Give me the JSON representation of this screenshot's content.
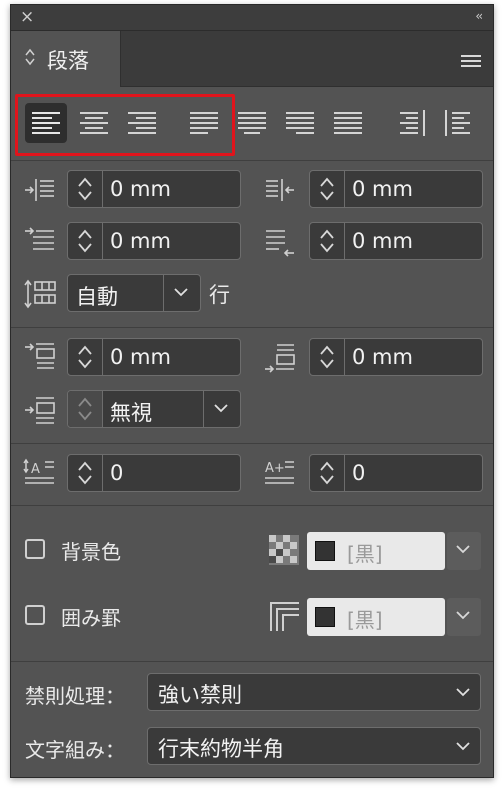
{
  "window": {
    "close_glyph": "×",
    "collapse_glyph": "‹‹"
  },
  "tab": {
    "label": "段落"
  },
  "alignment": {
    "buttons": [
      {
        "name": "align-left",
        "active": true
      },
      {
        "name": "align-center",
        "active": false
      },
      {
        "name": "align-right",
        "active": false
      },
      {
        "name": "justify-left",
        "active": false
      },
      {
        "name": "justify-center",
        "active": false
      },
      {
        "name": "justify-right",
        "active": false
      },
      {
        "name": "justify-all",
        "active": false
      },
      {
        "name": "align-toward-spine",
        "active": false
      },
      {
        "name": "align-away-from-spine",
        "active": false
      }
    ],
    "highlight_color": "#e0141c"
  },
  "indents": {
    "left_indent": "0 mm",
    "right_indent": "0 mm",
    "first_line_indent": "0 mm",
    "last_line_right_indent": "0 mm"
  },
  "leading": {
    "value": "自動",
    "suffix": "行"
  },
  "spacing": {
    "space_before": "0 mm",
    "space_after": "0 mm",
    "grid_align": "無視"
  },
  "dropcap": {
    "lines": "0",
    "chars": "0"
  },
  "shading": {
    "label": "背景色",
    "color_text": "[黒]"
  },
  "border": {
    "label": "囲み罫",
    "color_text": "[黒]"
  },
  "kinsoku": {
    "label": "禁則処理：",
    "value": "強い禁則"
  },
  "mojikumi": {
    "label": "文字組み：",
    "value": "行末約物半角"
  }
}
